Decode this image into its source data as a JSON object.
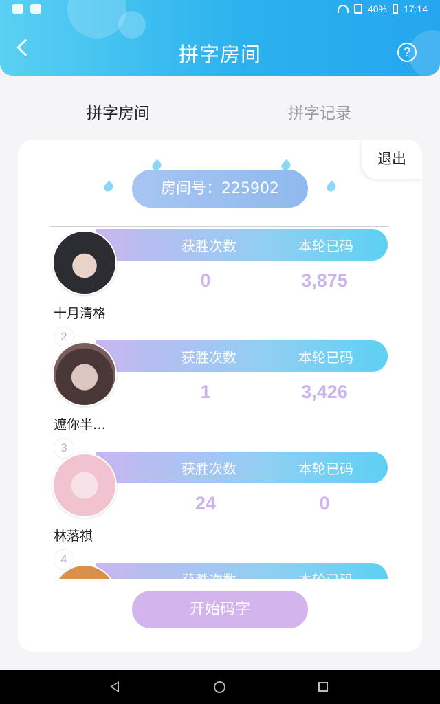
{
  "status_bar": {
    "battery": "40%",
    "time": "17:14"
  },
  "header": {
    "title": "拼字房间",
    "help_glyph": "?"
  },
  "tabs": [
    {
      "label": "拼字房间",
      "active": true
    },
    {
      "label": "拼字记录",
      "active": false
    }
  ],
  "room": {
    "exit_label": "退出",
    "room_number": "房间号：225902"
  },
  "columns": {
    "wins": "获胜次数",
    "typed": "本轮已码"
  },
  "players": [
    {
      "rank": "",
      "name": "十月清格",
      "wins": "0",
      "typed": "3,875"
    },
    {
      "rank": "2",
      "name": "遮你半…",
      "wins": "1",
      "typed": "3,426"
    },
    {
      "rank": "3",
      "name": "林落祺",
      "wins": "24",
      "typed": "0"
    },
    {
      "rank": "4",
      "name": "",
      "wins": "",
      "typed": ""
    }
  ],
  "start_button": "开始码字",
  "colors": {
    "header": "#2bb2ee",
    "accent_purple": "#d3b4ec",
    "values": "#cdb3ec"
  }
}
